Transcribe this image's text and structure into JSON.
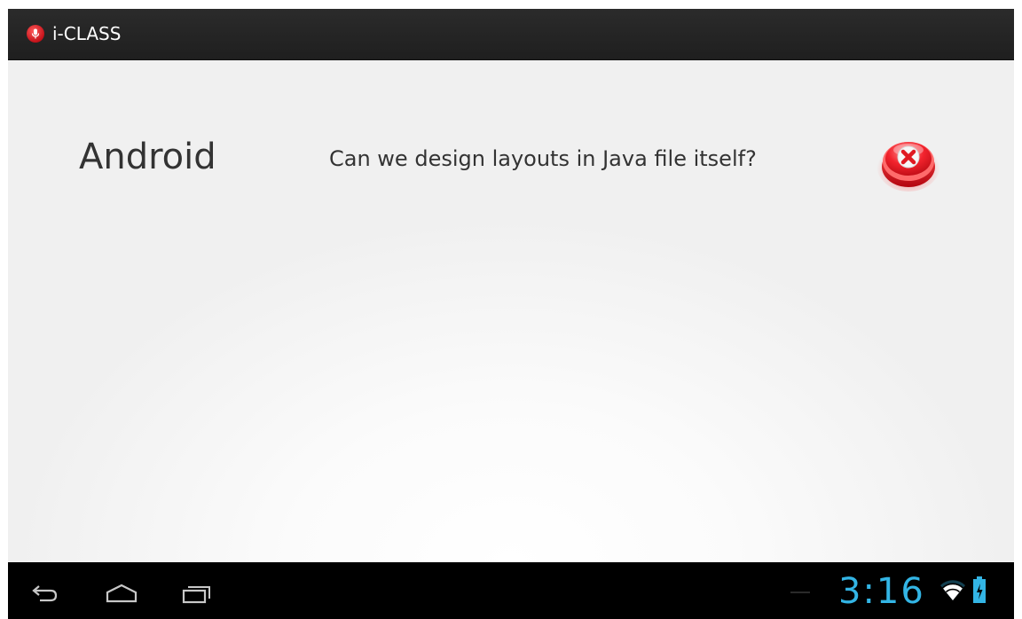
{
  "action_bar": {
    "title": "i-CLASS",
    "icon": "microphone-icon"
  },
  "content": {
    "subject": "Android",
    "question": "Can we design layouts in Java file itself?",
    "delete_icon": "close-icon"
  },
  "nav_bar": {
    "back_icon": "back-icon",
    "home_icon": "home-icon",
    "recent_icon": "recent-apps-icon"
  },
  "status": {
    "time": "3:16",
    "wifi_icon": "wifi-icon",
    "battery_icon": "battery-charging-icon",
    "accent_color": "#33b5e5"
  },
  "colors": {
    "action_bar": "#222222",
    "nav_bar": "#000000",
    "brand_red": "#d0141c"
  }
}
